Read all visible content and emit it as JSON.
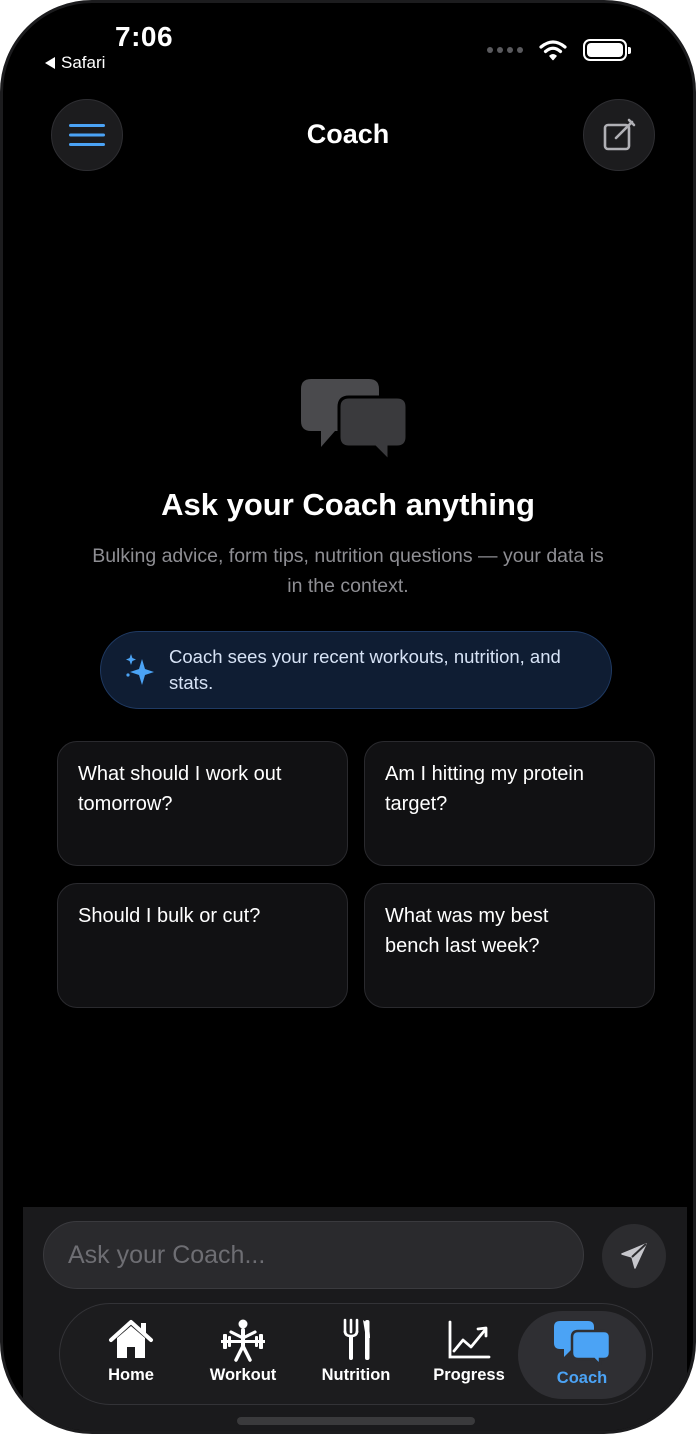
{
  "status_bar": {
    "time": "7:06",
    "back_app": "Safari"
  },
  "header": {
    "title": "Coach"
  },
  "empty_state": {
    "title": "Ask your Coach anything",
    "subtitle": "Bulking advice, form tips, nutrition questions — your data is in the context.",
    "context_note": "Coach sees your recent workouts, nutrition, and stats."
  },
  "suggestions": [
    "What should I work out tomorrow?",
    "Am I hitting my protein target?",
    "Should I bulk or cut?",
    "What was my best bench last week?"
  ],
  "composer": {
    "placeholder": "Ask your Coach..."
  },
  "tabs": [
    {
      "label": "Home",
      "icon": "house-icon"
    },
    {
      "label": "Workout",
      "icon": "weightlifter-icon"
    },
    {
      "label": "Nutrition",
      "icon": "fork-knife-icon"
    },
    {
      "label": "Progress",
      "icon": "chart-line-icon"
    },
    {
      "label": "Coach",
      "icon": "chat-bubbles-icon"
    }
  ],
  "active_tab": "Coach",
  "colors": {
    "accent": "#4ba3f5",
    "background": "#000000",
    "card": "#111113",
    "pill_bg": "#0f1d33"
  }
}
